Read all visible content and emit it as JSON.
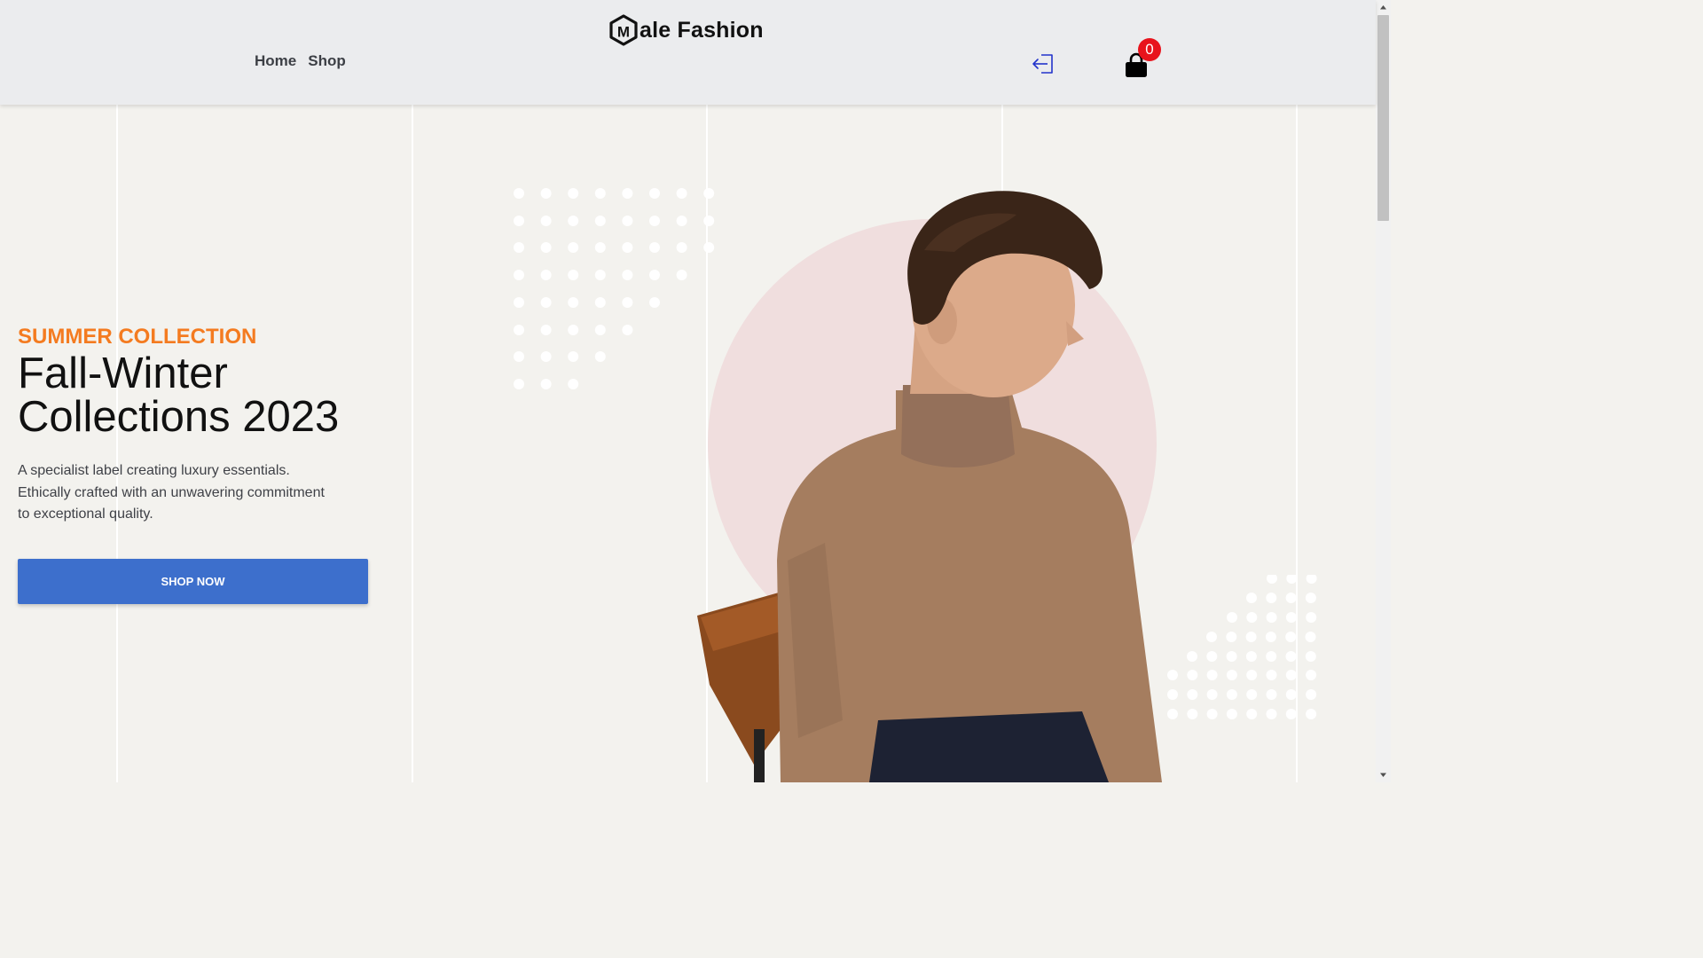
{
  "header": {
    "brand": "ale Fashion",
    "brand_logo_letter": "M",
    "nav": [
      {
        "label": "Home"
      },
      {
        "label": "Shop"
      }
    ],
    "login_icon": "sign-in-icon",
    "cart_icon": "shopping-bag-icon",
    "cart_count": "0"
  },
  "hero": {
    "eyebrow": "SUMMER COLLECTION",
    "title_line1": "Fall-Winter",
    "title_line2": "Collections 2023",
    "description": "A specialist label creating luxury essentials. Ethically crafted with an unwavering commitment to exceptional quality.",
    "cta_label": "SHOP NOW",
    "image": "man-in-turtleneck-on-chair"
  },
  "colors": {
    "accent_orange": "#f47b20",
    "button_blue": "#3d6fcc",
    "badge_red": "#e8131c",
    "circle_pink": "#f0dede",
    "sweater_brown": "#a57d5f",
    "header_bg": "#ebecee",
    "page_bg": "#f3f2ee"
  }
}
